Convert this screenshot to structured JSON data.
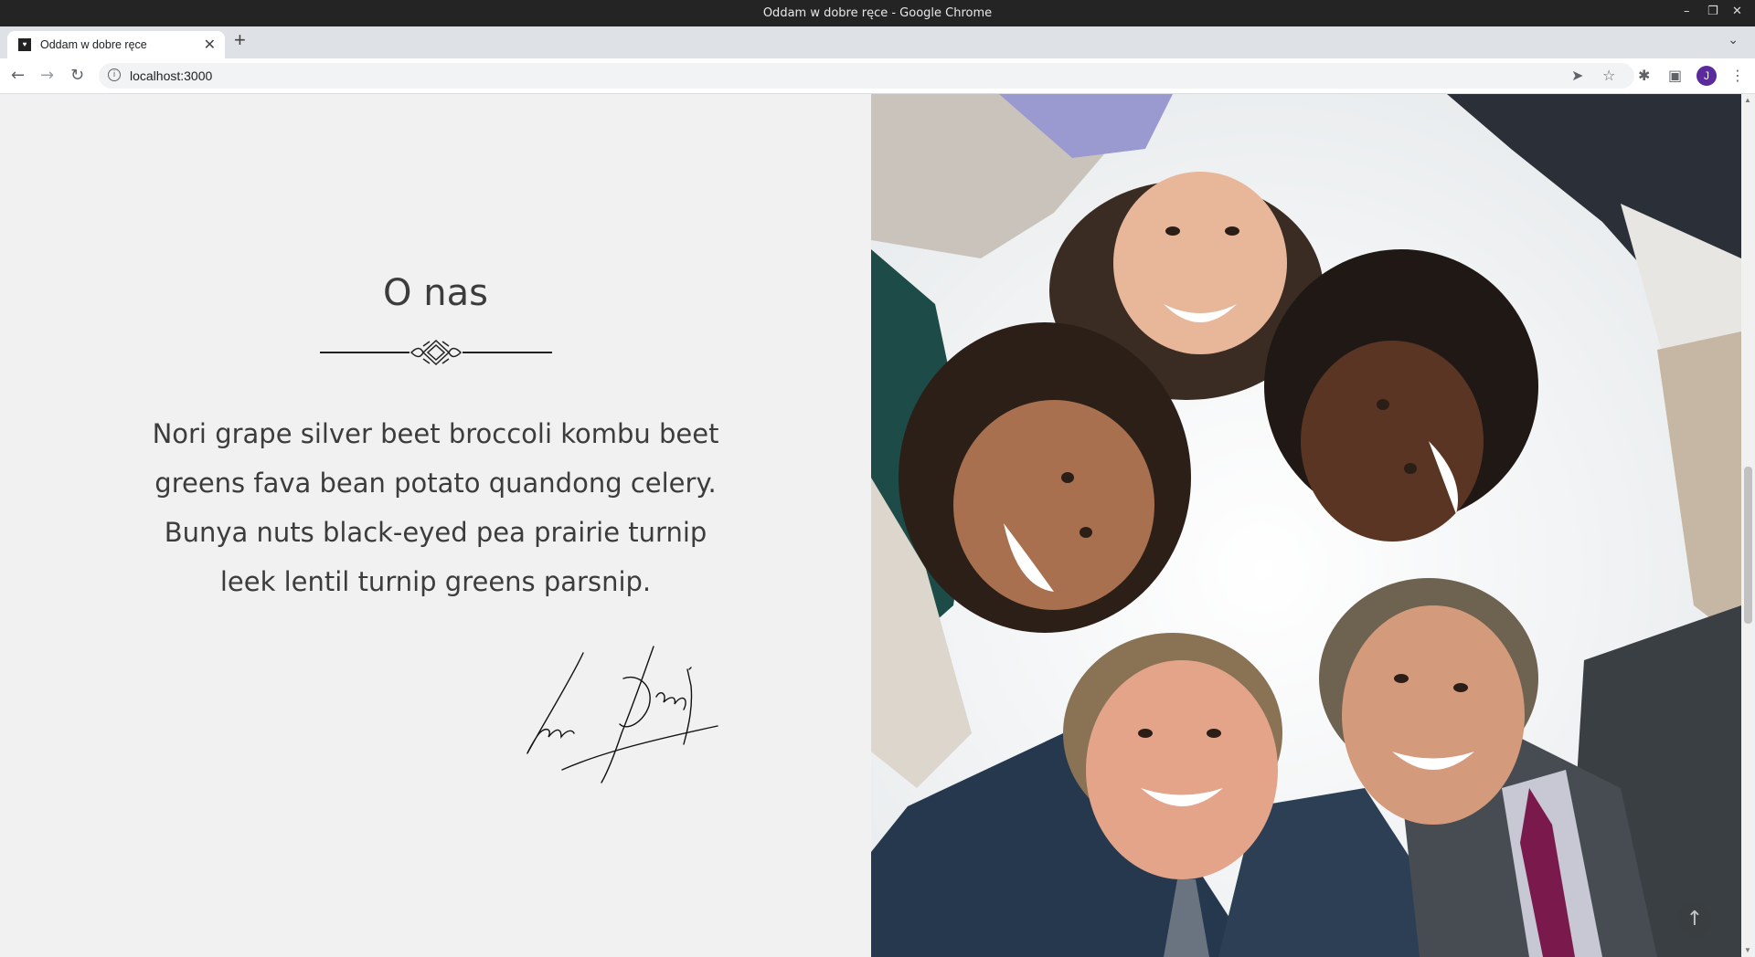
{
  "window": {
    "title": "Oddam w dobre ręce - Google Chrome",
    "controls": [
      "–",
      "❐",
      "✕"
    ]
  },
  "tabs": [
    {
      "label": "Oddam w dobre ręce",
      "active": true
    }
  ],
  "toolbar": {
    "url": "localhost:3000",
    "profile_initial": "J",
    "icons": [
      "back-icon",
      "forward-icon",
      "reload-icon",
      "send-icon",
      "star-icon",
      "extensions-icon",
      "side-panel-icon",
      "menu-icon"
    ]
  },
  "about": {
    "heading": "O nas",
    "text": "Nori grape silver beet broccoli kombu beet greens fava bean potato quandong celery. Bunya nuts black-eyed pea prairie turnip leek lentil turnip greens parsnip.",
    "signature": "Signature"
  },
  "photo": {
    "description": "group-of-smiling-people"
  },
  "colors": {
    "page_bg": "#f0f1f0",
    "text": "#3c3c3c",
    "avatar": "#5b2b9e"
  }
}
